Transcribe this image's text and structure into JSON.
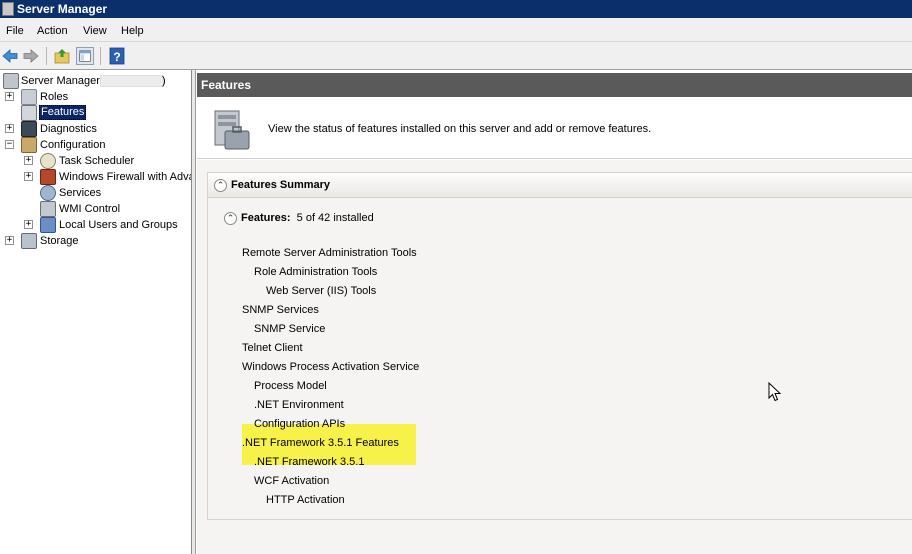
{
  "window": {
    "title": "Server Manager"
  },
  "menu": [
    {
      "label": "File"
    },
    {
      "label": "Action"
    },
    {
      "label": "View"
    },
    {
      "label": "Help"
    }
  ],
  "toolbar": {
    "buttons": [
      "back-icon",
      "forward-icon",
      "up-folder-icon",
      "show-hide-console-tree-icon",
      "help-icon"
    ]
  },
  "tree": {
    "root": "Server Manager (",
    "root_suffix": ")",
    "roles": "Roles",
    "features": "Features",
    "diagnostics": "Diagnostics",
    "configuration": "Configuration",
    "task_scheduler": "Task Scheduler",
    "firewall": "Windows Firewall with Adva",
    "services": "Services",
    "wmi": "WMI Control",
    "local_users": "Local Users and Groups",
    "storage": "Storage"
  },
  "content": {
    "header": "Features",
    "description": "View the status of features installed on this server and add or remove features.",
    "summary_title": "Features Summary",
    "features_label": "Features:",
    "features_count": "5 of 42 installed",
    "items": [
      "Remote Server Administration Tools",
      "Role Administration Tools",
      "Web Server (IIS) Tools",
      "SNMP Services",
      "SNMP Service",
      "Telnet Client",
      "Windows Process Activation Service",
      "Process Model",
      ".NET Environment",
      "Configuration APIs",
      ".NET Framework 3.5.1 Features",
      ".NET Framework 3.5.1",
      "WCF Activation",
      "HTTP Activation"
    ]
  },
  "colors": {
    "titlebar": "#0b2f6b",
    "content_header": "#5a5a5a",
    "highlight": "#f7f249",
    "selection": "#0a246a"
  }
}
